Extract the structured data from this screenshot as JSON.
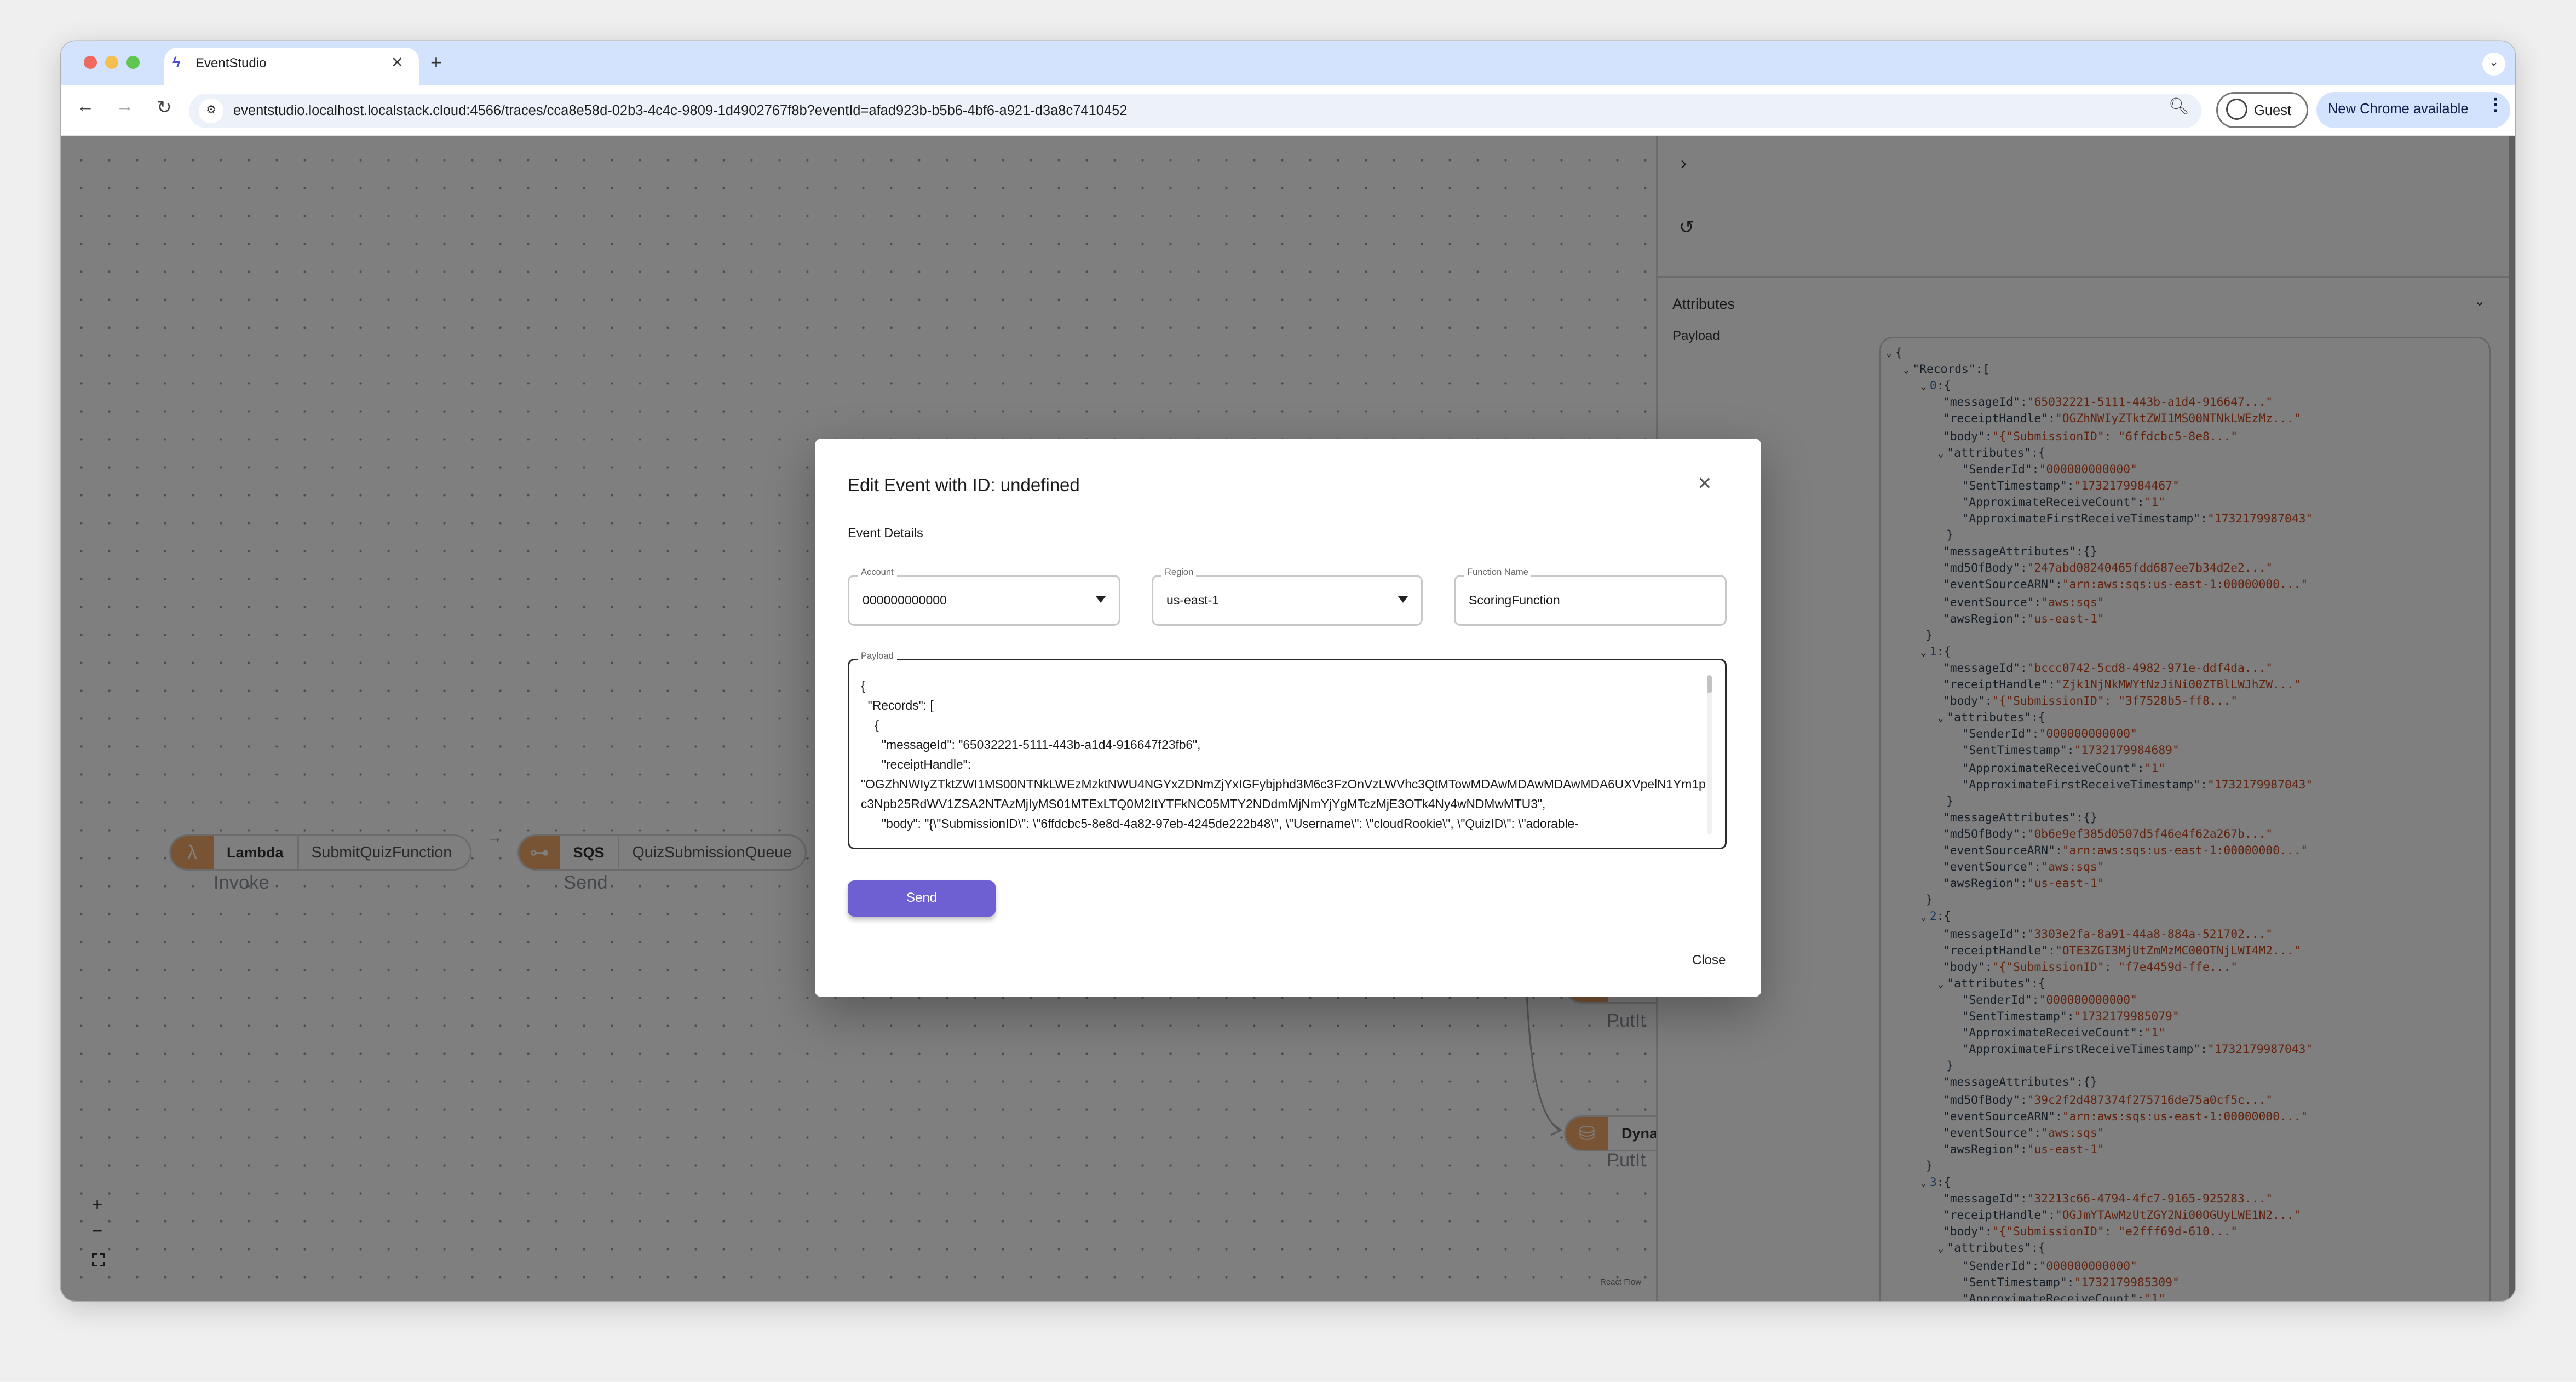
{
  "browser": {
    "tab_title": "EventStudio",
    "url": "eventstudio.localhost.localstack.cloud:4566/traces/cca8e58d-02b3-4c4c-9809-1d4902767f8b?eventId=afad923b-b5b6-4bf6-a921-d3a8c7410452",
    "profile_label": "Guest",
    "update_label": "New Chrome available",
    "colors": {
      "tabbar": "#d3e3fd",
      "omnibox": "#edf2fa"
    }
  },
  "canvas": {
    "nodes": [
      {
        "service": "Lambda",
        "resource": "SubmitQuizFunction",
        "operation": "Invoke",
        "icon": "lambda-icon"
      },
      {
        "service": "SQS",
        "resource": "QuizSubmissionQueue",
        "operation": "Send",
        "icon": "sqs-icon"
      },
      {
        "service": "Dyna",
        "operation": "PutIt",
        "icon": "dynamodb-icon"
      }
    ],
    "upper_hidden_node_operation": "PutIt",
    "zoom_in": "+",
    "zoom_out": "−",
    "attribution": "React Flow"
  },
  "panel": {
    "attributes_label": "Attributes",
    "payload_label": "Payload",
    "records": [
      {
        "index": "0",
        "messageId": "\"65032221-5111-443b-a1d4-916647...\"",
        "receiptHandle": "\"OGZhNWIyZTktZWI1MS00NTNkLWEzMz...\"",
        "body": "\"{\"SubmissionID\": \"6ffdcbc5-8e8...\"",
        "SenderId": "\"000000000000\"",
        "SentTimestamp": "\"1732179984467\"",
        "ApproximateReceiveCount": "\"1\"",
        "ApproximateFirstReceiveTimestamp": "\"1732179987043\"",
        "messageAttributes": "{}",
        "md5OfBody": "\"247abd08240465fdd687ee7b34d2e2...\"",
        "eventSourceARN": "\"arn:aws:sqs:us-east-1:00000000...\"",
        "eventSource": "\"aws:sqs\"",
        "awsRegion": "\"us-east-1\""
      },
      {
        "index": "1",
        "messageId": "\"bccc0742-5cd8-4982-971e-ddf4da...\"",
        "receiptHandle": "\"Zjk1NjNkMWYtNzJiNi00ZTBlLWJhZW...\"",
        "body": "\"{\"SubmissionID\": \"3f7528b5-ff8...\"",
        "SenderId": "\"000000000000\"",
        "SentTimestamp": "\"1732179984689\"",
        "ApproximateReceiveCount": "\"1\"",
        "ApproximateFirstReceiveTimestamp": "\"1732179987043\"",
        "messageAttributes": "{}",
        "md5OfBody": "\"0b6e9ef385d0507d5f46e4f62a267b...\"",
        "eventSourceARN": "\"arn:aws:sqs:us-east-1:00000000...\"",
        "eventSource": "\"aws:sqs\"",
        "awsRegion": "\"us-east-1\""
      },
      {
        "index": "2",
        "messageId": "\"3303e2fa-8a91-44a8-884a-521702...\"",
        "receiptHandle": "\"OTE3ZGI3MjUtZmMzMC00OTNjLWI4M2...\"",
        "body": "\"{\"SubmissionID\": \"f7e4459d-ffe...\"",
        "SenderId": "\"000000000000\"",
        "SentTimestamp": "\"1732179985079\"",
        "ApproximateReceiveCount": "\"1\"",
        "ApproximateFirstReceiveTimestamp": "\"1732179987043\"",
        "messageAttributes": "{}",
        "md5OfBody": "\"39c2f2d487374f275716de75a0cf5c...\"",
        "eventSourceARN": "\"arn:aws:sqs:us-east-1:00000000...\"",
        "eventSource": "\"aws:sqs\"",
        "awsRegion": "\"us-east-1\""
      },
      {
        "index": "3",
        "messageId": "\"32213c66-4794-4fc7-9165-925283...\"",
        "receiptHandle": "\"OGJmYTAwMzUtZGY2Ni00OGUyLWE1N2...\"",
        "body": "\"{\"SubmissionID\": \"e2fff69d-610...\"",
        "SenderId": "\"000000000000\"",
        "SentTimestamp": "\"1732179985309\"",
        "ApproximateReceiveCount": "\"1\""
      }
    ],
    "colors": {
      "key": "#2c3e50",
      "string": "#c4461c",
      "index": "#2f6db5"
    }
  },
  "modal": {
    "title": "Edit Event with ID: undefined",
    "section_label": "Event Details",
    "account": {
      "label": "Account",
      "value": "000000000000"
    },
    "region": {
      "label": "Region",
      "value": "us-east-1"
    },
    "function_name": {
      "label": "Function Name",
      "value": "ScoringFunction"
    },
    "payload": {
      "label": "Payload",
      "lines": [
        "{",
        "  \"Records\": [",
        "    {",
        "      \"messageId\": \"65032221-5111-443b-a1d4-916647f23fb6\",",
        "      \"receiptHandle\":",
        "\"OGZhNWIyZTktZWI1MS00NTNkLWEzMzktNWU4NGYxZDNmZjYxIGFybjphd3M6c3FzOnVzLWVhc3QtMTowMDAwMDAwMDAwMDA6UXVpelN1Ym1pc3Npb25RdWV1ZSA2NTAzMjIyMS01MTExLTQ0M2ItYTFkNC05MTY2NDdmMjNmYjYgMTczMjE3OTk4Ny4wNDMwMTU3\",",
        "      \"body\": \"{\\\"SubmissionID\\\": \\\"6ffdcbc5-8e8d-4a82-97eb-4245de222b48\\\", \\\"Username\\\": \\\"cloudRookie\\\", \\\"QuizID\\\": \\\"adorable-"
      ]
    },
    "send_label": "Send",
    "close_label": "Close",
    "accent": "#6e5fd3"
  }
}
